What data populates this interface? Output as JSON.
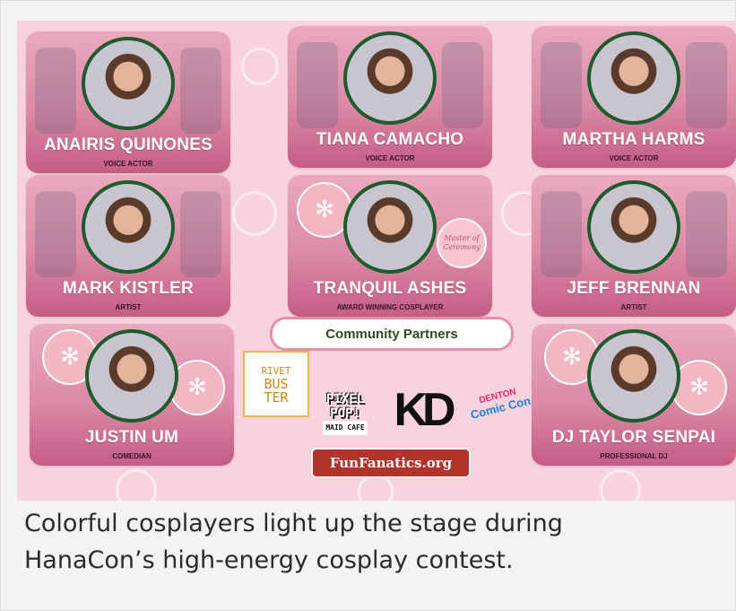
{
  "page": {
    "background": "#f3f3f3",
    "poster_background": "#f8d3dd"
  },
  "cards": [
    {
      "name": "ANAIRIS QUINONES",
      "role": "VOICE ACTOR"
    },
    {
      "name": "TIANA CAMACHO",
      "role": "VOICE ACTOR"
    },
    {
      "name": "MARTHA HARMS",
      "role": "VOICE ACTOR"
    },
    {
      "name": "MARK KISTLER",
      "role": "ARTIST"
    },
    {
      "name": "TRANQUIL ASHES",
      "role": "AWARD WINNING COSPLAYER",
      "badge": "Master of Ceremony"
    },
    {
      "name": "JEFF BRENNAN",
      "role": "ARTIST"
    },
    {
      "name": "JUSTIN UM",
      "role": "COMEDIAN"
    },
    {
      "name": "DJ TAYLOR SENPAI",
      "role": "PROFESSIONAL DJ"
    }
  ],
  "partners": {
    "heading": "Community Partners",
    "logos": {
      "rivet": [
        "RIVET",
        "BUS",
        "TER"
      ],
      "pixel": [
        "PIXEL",
        "POP!",
        "MAID CAFE"
      ],
      "kd": "KD",
      "comiccon": [
        "DENTON",
        "Comic Con"
      ],
      "funfanatics": "FunFanatics.org"
    }
  },
  "caption": {
    "line1": "Colorful cosplayers light up the stage during",
    "line2": "HanaCon’s high-energy cosplay contest."
  },
  "colors": {
    "card_gradient_top": "#e9aabd",
    "card_gradient_bottom": "#c45d85",
    "ring": "#1d5a2e",
    "partners_border": "#e58fad",
    "partners_text": "#2f4c1f"
  }
}
